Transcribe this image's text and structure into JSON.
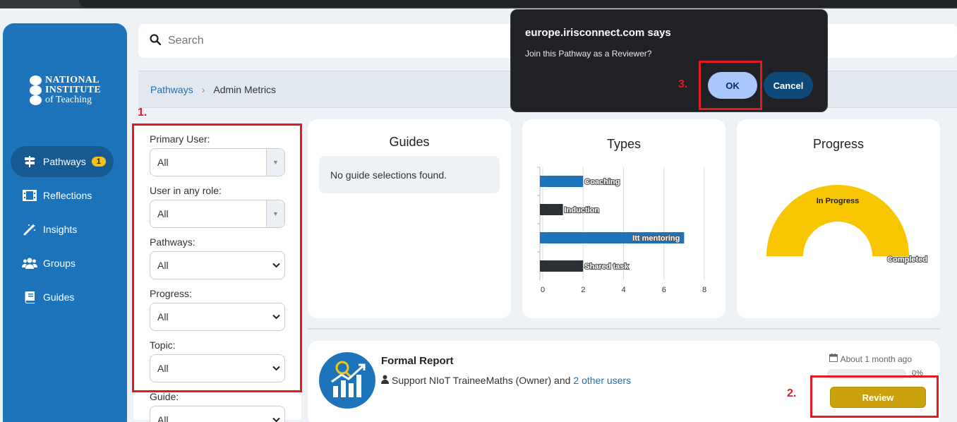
{
  "dialog": {
    "title": "europe.irisconnect.com says",
    "message": "Join this Pathway as a Reviewer?",
    "ok_label": "OK",
    "cancel_label": "Cancel"
  },
  "brand": {
    "logo_line1": "NATIONAL",
    "logo_line2": "INSTITUTE",
    "logo_line3": "of Teaching",
    "sidebar_color": "#1e74bb"
  },
  "sidebar": {
    "items": [
      {
        "label": "Pathways",
        "icon": "signpost-icon",
        "badge": "1",
        "active": true
      },
      {
        "label": "Reflections",
        "icon": "film-icon"
      },
      {
        "label": "Insights",
        "icon": "magic-wand-icon"
      },
      {
        "label": "Groups",
        "icon": "users-icon"
      },
      {
        "label": "Guides",
        "icon": "book-icon"
      }
    ]
  },
  "search": {
    "placeholder": "Search"
  },
  "breadcrumb": {
    "root": "Pathways",
    "current": "Admin Metrics"
  },
  "filters": {
    "primary_user": {
      "label": "Primary User:",
      "value": "All"
    },
    "user_any_role": {
      "label": "User in any role:",
      "value": "All"
    },
    "pathways": {
      "label": "Pathways:",
      "value": "All"
    },
    "progress": {
      "label": "Progress:",
      "value": "All"
    },
    "topic": {
      "label": "Topic:",
      "value": "All"
    },
    "guide": {
      "label": "Guide:",
      "value": "All"
    }
  },
  "guides_card": {
    "title": "Guides",
    "empty": "No guide selections found."
  },
  "types_card": {
    "title": "Types"
  },
  "progress_card": {
    "title": "Progress"
  },
  "chart_data": [
    {
      "type": "bar",
      "orientation": "horizontal",
      "title": "Types",
      "categories": [
        "Coaching",
        "Induction",
        "Itt mentoring",
        "Shared task"
      ],
      "values": [
        2,
        1,
        7,
        2
      ],
      "colors": [
        "#1e74bb",
        "#2b2f36",
        "#1e74bb",
        "#2b2f36"
      ],
      "xlim": [
        0,
        8
      ],
      "xticks": [
        "0",
        "2",
        "4",
        "6",
        "8"
      ],
      "grid": true
    },
    {
      "type": "pie",
      "style": "half-donut",
      "title": "Progress",
      "categories": [
        "In Progress",
        "Completed"
      ],
      "values": [
        1,
        0
      ],
      "colors": [
        "#f7c600",
        "#1e74bb"
      ]
    }
  ],
  "report": {
    "title": "Formal Report",
    "owner_text": "Support NIoT TraineeMaths (Owner) and",
    "others_link": "2 other users",
    "time": "About 1 month ago",
    "progress_percent": 0,
    "progress_text": "0%",
    "review_label": "Review"
  },
  "annotations": {
    "step1": "1.",
    "step2": "2.",
    "step3": "3."
  }
}
